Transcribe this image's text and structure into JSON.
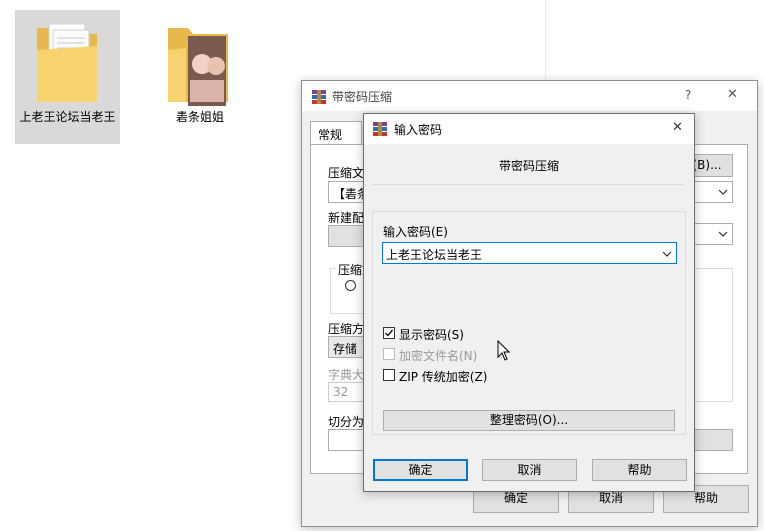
{
  "desktop": {
    "items": [
      {
        "label": "上老王论坛当老王",
        "selected": true
      },
      {
        "label": "砉条姐姐",
        "selected": false
      }
    ]
  },
  "back_dialog": {
    "title": "带密码压缩",
    "help_glyph": "?",
    "close_glyph": "✕",
    "tab_general": "常规",
    "compress_file_label": "压缩文",
    "file_value": "【砉条",
    "new_config_label": "新建配",
    "compress_group_label": "压缩文",
    "compress_method_label": "压缩方",
    "compress_method_value": "存储",
    "dict_size_label": "字典大",
    "dict_size_value": "32",
    "split_label": "切分为",
    "browse_button": "(B)...",
    "ok_button": "确定",
    "cancel_button": "取消",
    "help_button": "帮助"
  },
  "password_dialog": {
    "title": "输入密码",
    "close_glyph": "✕",
    "heading": "带密码压缩",
    "password_label": "输入密码(E)",
    "password_value": "上老王论坛当老王",
    "checkboxes": [
      {
        "label": "显示密码(S)",
        "checked": true,
        "enabled": true
      },
      {
        "label": "加密文件名(N)",
        "checked": false,
        "enabled": false
      },
      {
        "label": "ZIP 传统加密(Z)",
        "checked": false,
        "enabled": true
      }
    ],
    "organize_button": "整理密码(O)...",
    "ok_button": "确定",
    "cancel_button": "取消",
    "help_button": "帮助"
  },
  "colors": {
    "accent": "#0078d7",
    "selection": "#d9d9d9",
    "dialog_bg": "#f0f0f0"
  }
}
